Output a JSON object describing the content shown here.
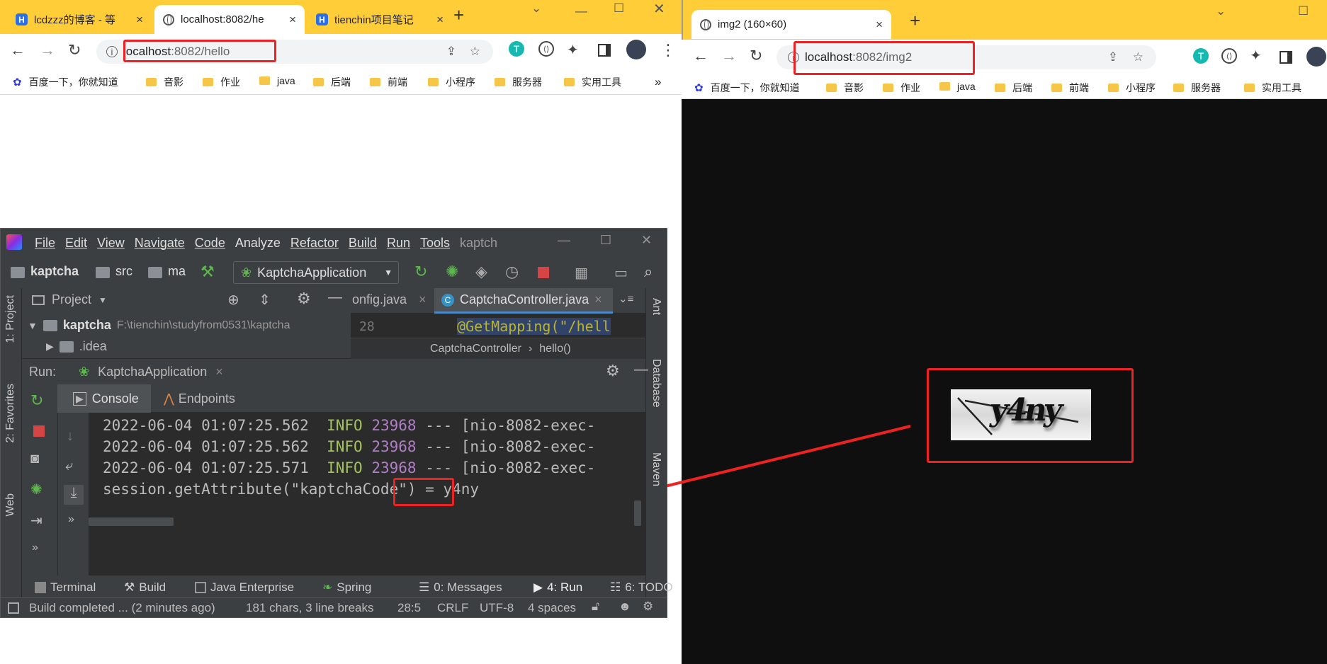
{
  "left_browser": {
    "tabs": [
      {
        "title": "lcdzzz的博客 - 等",
        "favicon": "H"
      },
      {
        "title": "localhost:8082/he",
        "active": true
      },
      {
        "title": "tienchin项目笔记",
        "favicon": "H"
      }
    ],
    "url": {
      "host": "localhost",
      "rest": ":8082/hello"
    },
    "bookmarks": [
      "百度一下，你就知道",
      "音影",
      "作业",
      "java",
      "后端",
      "前端",
      "小程序",
      "服务器",
      "实用工具"
    ],
    "more": "»"
  },
  "right_browser": {
    "tab_title": "img2 (160×60)",
    "url": {
      "host": "localhost",
      "rest": ":8082/img2"
    },
    "bookmarks": [
      "百度一下，你就知道",
      "音影",
      "作业",
      "java",
      "后端",
      "前端",
      "小程序",
      "服务器",
      "实用工具"
    ],
    "captcha_text": "y4ny"
  },
  "ide": {
    "menu": [
      "File",
      "Edit",
      "View",
      "Navigate",
      "Code",
      "Analyze",
      "Refactor",
      "Build",
      "Run",
      "Tools"
    ],
    "window_title": "kaptch",
    "breadcrumbs": [
      "kaptcha",
      "src",
      "ma"
    ],
    "run_config": "KaptchaApplication",
    "project_panel": {
      "label": "Project",
      "root": "kaptcha",
      "root_path": "F:\\tienchin\\studyfrom0531\\kaptcha",
      "child": ".idea"
    },
    "editor_tabs": [
      "onfig.java",
      "CaptchaController.java"
    ],
    "editor": {
      "line_no": "28",
      "code": "@GetMapping(\"/hell",
      "breadcrumb_class": "CaptchaController",
      "breadcrumb_method": "hello()"
    },
    "run_panel": {
      "label": "Run:",
      "config": "KaptchaApplication",
      "tabs": [
        "Console",
        "Endpoints"
      ]
    },
    "console_lines": [
      {
        "ts": "2022-06-04 01:07:25.562",
        "level": "INFO",
        "pid": "23968",
        "rest": " --- [nio-8082-exec-"
      },
      {
        "ts": "2022-06-04 01:07:25.562",
        "level": "INFO",
        "pid": "23968",
        "rest": " --- [nio-8082-exec-"
      },
      {
        "ts": "2022-06-04 01:07:25.571",
        "level": "INFO",
        "pid": "23968",
        "rest": " --- [nio-8082-exec-"
      }
    ],
    "session_line": "session.getAttribute(\"kaptchaCode\") = ",
    "session_value": "y4ny",
    "left_tool_windows": [
      "1: Project",
      "2: Favorites",
      "Web"
    ],
    "right_tool_windows": [
      "Ant",
      "Database",
      "Maven"
    ],
    "bottom_tabs": [
      "Terminal",
      "Build",
      "Java Enterprise",
      "Spring",
      "0: Messages",
      "4: Run",
      "6: TODO"
    ],
    "status": {
      "message": "Build completed ... (2 minutes ago)",
      "chars": "181 chars, 3 line breaks",
      "pos": "28:5",
      "eol": "CRLF",
      "enc": "UTF-8",
      "indent": "4 spaces"
    }
  },
  "colors": {
    "highlight": "#ee2222",
    "tabbar": "#ffcd38",
    "ide_bg": "#3c3f41",
    "console_bg": "#2b2b2b"
  }
}
